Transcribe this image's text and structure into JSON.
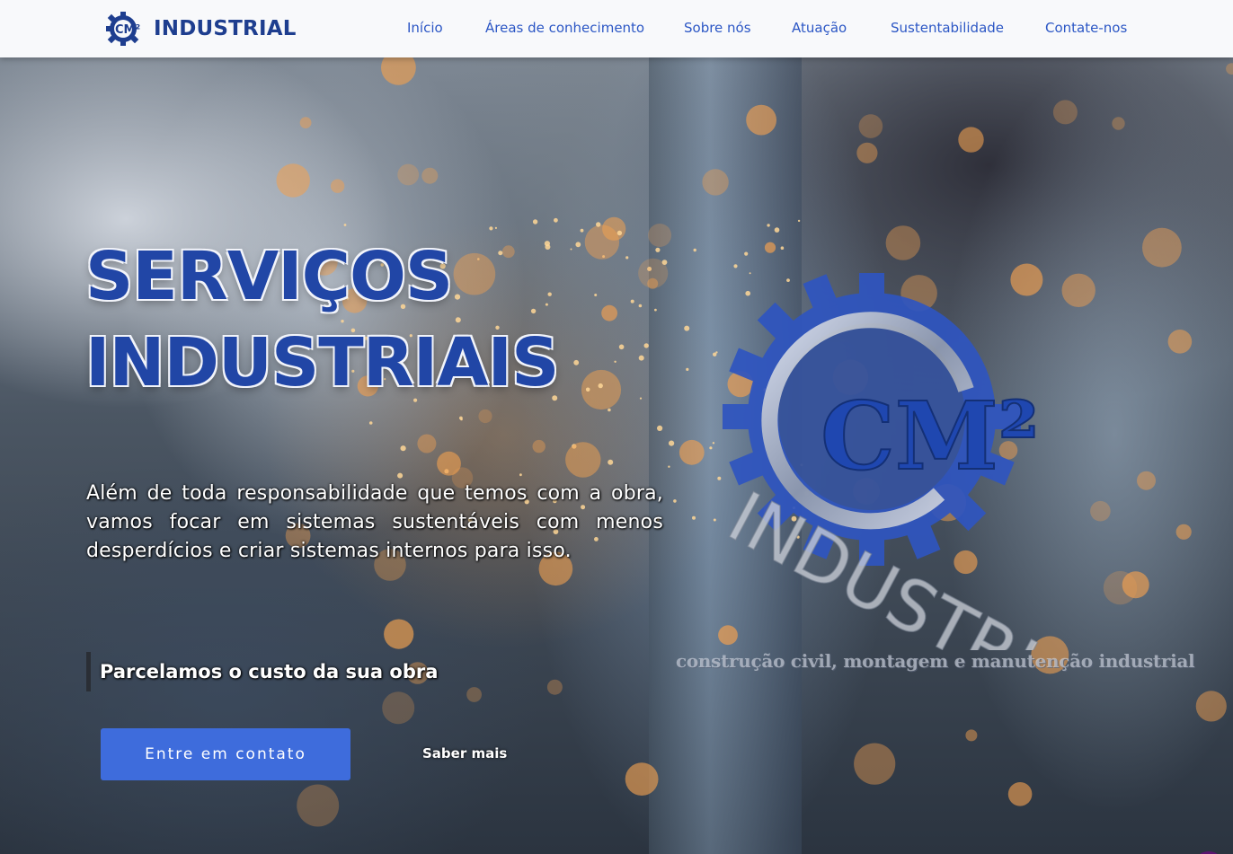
{
  "brand": {
    "logo_text": "CM²",
    "name": "INDUSTRIAL"
  },
  "nav": [
    {
      "label": "Início"
    },
    {
      "label": "Áreas de conhecimento"
    },
    {
      "label": "Sobre nós"
    },
    {
      "label": "Atuação"
    },
    {
      "label": "Sustentabilidade"
    },
    {
      "label": "Contate-nos"
    }
  ],
  "hero": {
    "title_line1": "SERVIÇOS",
    "title_line2": "INDUSTRIAIS",
    "description": "Além de toda responsabilidade que temos com a obra, vamos focar em sistemas sustentáveis com menos desperdícios e criar sistemas internos para isso.",
    "highlight": "Parcelamos o custo da sua obra",
    "contact_button": "Entre em contato",
    "more_link": "Saber mais"
  },
  "big_logo": {
    "mark": "CM²",
    "word": "INDUSTRIAL",
    "tagline": "construção civil, montagem e manutenção industrial"
  },
  "badge": {
    "count": "0"
  },
  "colors": {
    "brand_blue": "#1e3e8f",
    "nav_blue": "#2c57c5",
    "button_blue": "#3e6cdc",
    "gear_blue": "#2f55c0",
    "badge_purple": "#5b1470"
  },
  "icons": {
    "brand": "gear-logo-icon",
    "big_logo": "gear-emblem-icon"
  }
}
